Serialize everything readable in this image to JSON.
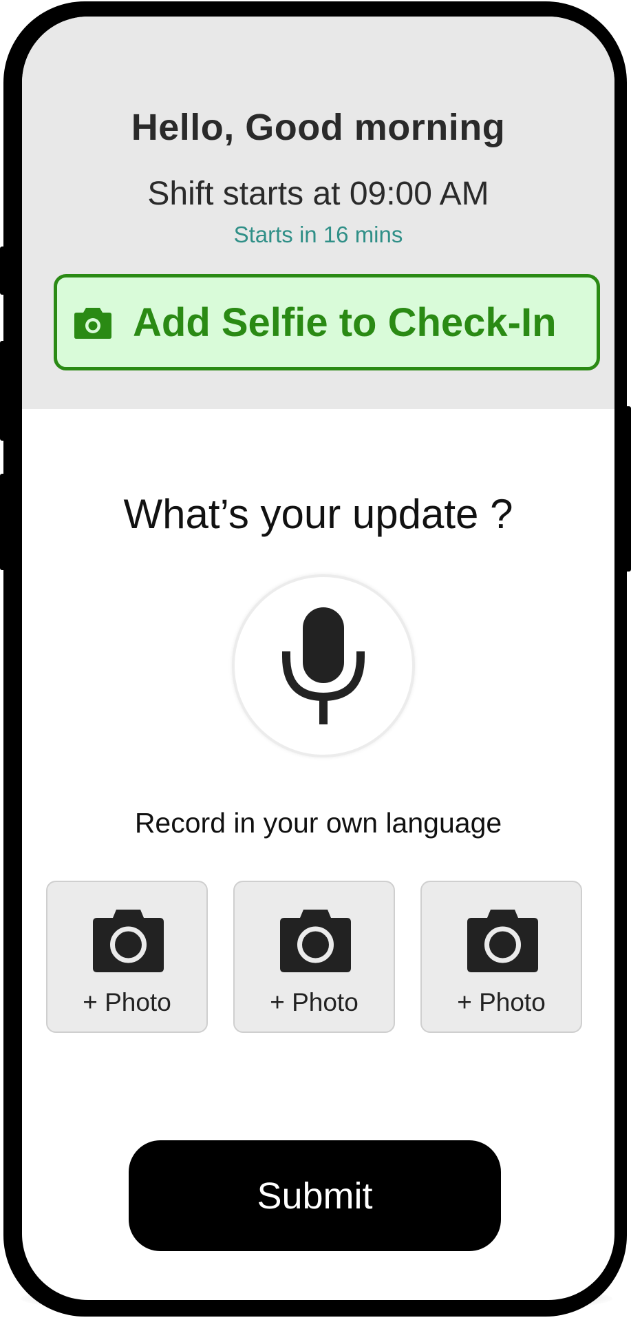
{
  "header": {
    "greeting": "Hello, Good morning",
    "shift_time": "Shift starts at 09:00 AM",
    "starts_in": "Starts in 16 mins"
  },
  "selfie_button": {
    "label": "Add Selfie to Check-In",
    "icon": "camera-icon"
  },
  "update": {
    "question": "What’s your update ?",
    "mic_icon": "microphone-icon",
    "hint": "Record in your own language"
  },
  "photos": [
    {
      "label": "+ Photo",
      "icon": "camera-icon"
    },
    {
      "label": "+ Photo",
      "icon": "camera-icon"
    },
    {
      "label": "+ Photo",
      "icon": "camera-icon"
    }
  ],
  "submit": {
    "label": "Submit"
  },
  "colors": {
    "header_bg": "#e8e8e8",
    "accent_green": "#2a8a14",
    "selfie_bg": "#d9fbd9",
    "teal_text": "#2f8f87",
    "submit_bg": "#000000"
  }
}
